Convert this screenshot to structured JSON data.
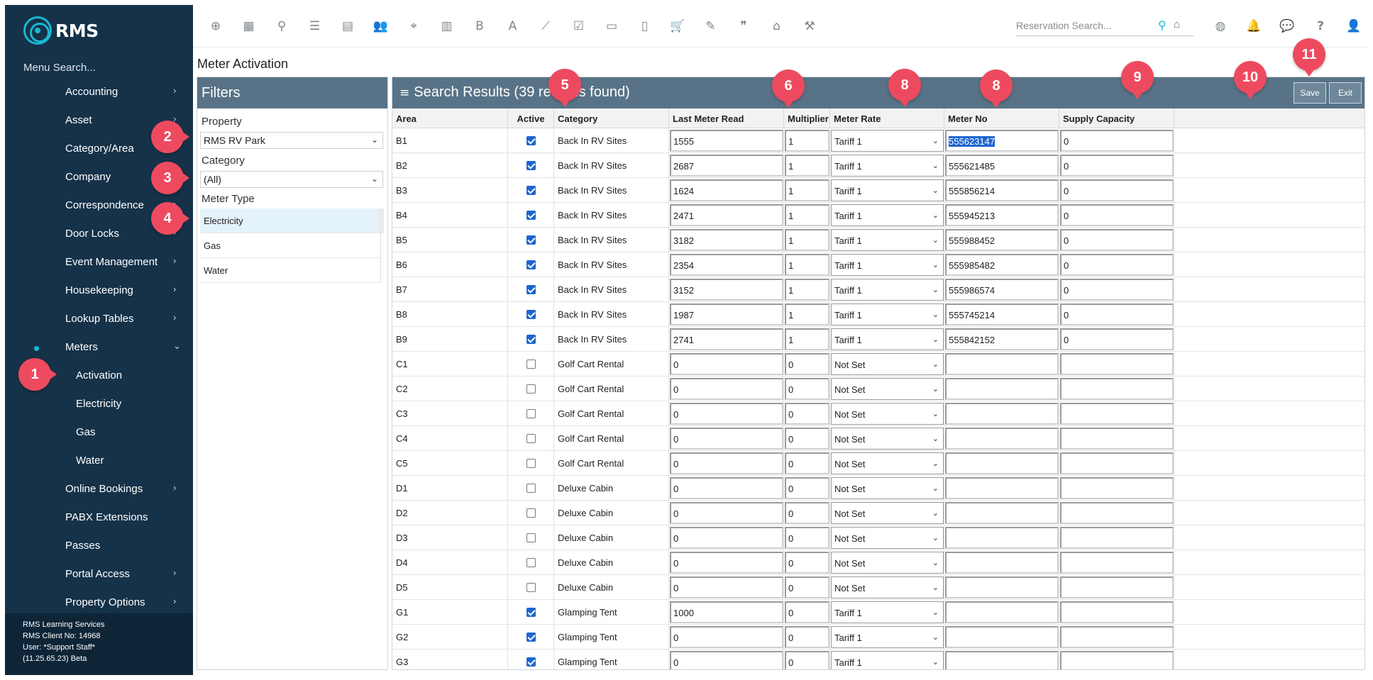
{
  "app": {
    "logo_text": "RMS",
    "menu_search_label": "Menu Search..."
  },
  "sidebar": {
    "items": [
      {
        "label": "Accounting",
        "chevron": "›"
      },
      {
        "label": "Asset",
        "chevron": "›"
      },
      {
        "label": "Category/Area",
        "chevron": ""
      },
      {
        "label": "Company",
        "chevron": "›"
      },
      {
        "label": "Correspondence",
        "chevron": "›"
      },
      {
        "label": "Door Locks",
        "chevron": "›"
      },
      {
        "label": "Event Management",
        "chevron": "›"
      },
      {
        "label": "Housekeeping",
        "chevron": "›"
      },
      {
        "label": "Lookup Tables",
        "chevron": "›"
      },
      {
        "label": "Meters",
        "chevron": "⌄"
      },
      {
        "label": "Activation",
        "chevron": ""
      },
      {
        "label": "Electricity",
        "chevron": ""
      },
      {
        "label": "Gas",
        "chevron": ""
      },
      {
        "label": "Water",
        "chevron": ""
      },
      {
        "label": "Online Bookings",
        "chevron": "›"
      },
      {
        "label": "PABX Extensions",
        "chevron": ""
      },
      {
        "label": "Passes",
        "chevron": ""
      },
      {
        "label": "Portal Access",
        "chevron": "›"
      },
      {
        "label": "Property Options",
        "chevron": "›"
      }
    ],
    "footer": {
      "line1": "RMS Learning Services",
      "line2": "RMS Client No: 14968",
      "line3": "User: *Support Staff*",
      "line4": "(11.25.65.23)  Beta"
    }
  },
  "toolbar": {
    "icons": [
      {
        "name": "add-icon",
        "glyph": "⊕"
      },
      {
        "name": "calendar-icon",
        "glyph": "▦"
      },
      {
        "name": "search-icon",
        "glyph": "⚲"
      },
      {
        "name": "sliders-icon",
        "glyph": "☰"
      },
      {
        "name": "grid-icon",
        "glyph": "▤"
      },
      {
        "name": "users-icon",
        "glyph": "👥"
      },
      {
        "name": "map-marker-icon",
        "glyph": "⌖"
      },
      {
        "name": "map-icon",
        "glyph": "▥"
      },
      {
        "name": "bold-icon",
        "glyph": "B"
      },
      {
        "name": "font-icon",
        "glyph": "A"
      },
      {
        "name": "chart-icon",
        "glyph": "⟋"
      },
      {
        "name": "checklist-icon",
        "glyph": "☑"
      },
      {
        "name": "id-card-icon",
        "glyph": "▭"
      },
      {
        "name": "document-icon",
        "glyph": "▯"
      },
      {
        "name": "cart-icon",
        "glyph": "🛒"
      },
      {
        "name": "signature-icon",
        "glyph": "✎"
      },
      {
        "name": "quote-icon",
        "glyph": "❞"
      },
      {
        "name": "bed-icon",
        "glyph": "⌂"
      },
      {
        "name": "hammer-icon",
        "glyph": "⚒"
      }
    ],
    "reservation_search_placeholder": "Reservation Search...",
    "right_icons": [
      {
        "name": "globe-icon",
        "glyph": "◍"
      },
      {
        "name": "bell-icon",
        "glyph": "🔔"
      },
      {
        "name": "chat-icon",
        "glyph": "💬"
      },
      {
        "name": "help-icon",
        "glyph": "?"
      },
      {
        "name": "user-icon",
        "glyph": "👤"
      }
    ]
  },
  "page": {
    "title": "Meter Activation"
  },
  "filters": {
    "title": "Filters",
    "property_label": "Property",
    "property_value": "RMS RV Park",
    "category_label": "Category",
    "category_value": "(All)",
    "meter_type_label": "Meter Type",
    "meter_types": [
      "Electricity",
      "Gas",
      "Water"
    ],
    "selected_meter_type": "Electricity"
  },
  "results": {
    "title": "Search Results (39 records found)",
    "save_label": "Save",
    "exit_label": "Exit",
    "columns": [
      "Area",
      "Active",
      "Category",
      "Last Meter Read",
      "Multiplier",
      "Meter Rate",
      "Meter No",
      "Supply Capacity"
    ],
    "rows": [
      {
        "area": "B1",
        "active": true,
        "category": "Back In RV Sites",
        "last_read": "1555",
        "multiplier": "1",
        "rate": "Tariff 1",
        "meter_no": "555623147",
        "capacity": "0"
      },
      {
        "area": "B2",
        "active": true,
        "category": "Back In RV Sites",
        "last_read": "2687",
        "multiplier": "1",
        "rate": "Tariff 1",
        "meter_no": "555621485",
        "capacity": "0"
      },
      {
        "area": "B3",
        "active": true,
        "category": "Back In RV Sites",
        "last_read": "1624",
        "multiplier": "1",
        "rate": "Tariff 1",
        "meter_no": "555856214",
        "capacity": "0"
      },
      {
        "area": "B4",
        "active": true,
        "category": "Back In RV Sites",
        "last_read": "2471",
        "multiplier": "1",
        "rate": "Tariff 1",
        "meter_no": "555945213",
        "capacity": "0"
      },
      {
        "area": "B5",
        "active": true,
        "category": "Back In RV Sites",
        "last_read": "3182",
        "multiplier": "1",
        "rate": "Tariff 1",
        "meter_no": "555988452",
        "capacity": "0"
      },
      {
        "area": "B6",
        "active": true,
        "category": "Back In RV Sites",
        "last_read": "2354",
        "multiplier": "1",
        "rate": "Tariff 1",
        "meter_no": "555985482",
        "capacity": "0"
      },
      {
        "area": "B7",
        "active": true,
        "category": "Back In RV Sites",
        "last_read": "3152",
        "multiplier": "1",
        "rate": "Tariff 1",
        "meter_no": "555986574",
        "capacity": "0"
      },
      {
        "area": "B8",
        "active": true,
        "category": "Back In RV Sites",
        "last_read": "1987",
        "multiplier": "1",
        "rate": "Tariff 1",
        "meter_no": "555745214",
        "capacity": "0"
      },
      {
        "area": "B9",
        "active": true,
        "category": "Back In RV Sites",
        "last_read": "2741",
        "multiplier": "1",
        "rate": "Tariff 1",
        "meter_no": "555842152",
        "capacity": "0"
      },
      {
        "area": "C1",
        "active": false,
        "category": "Golf Cart Rental",
        "last_read": "0",
        "multiplier": "0",
        "rate": "Not Set",
        "meter_no": "",
        "capacity": ""
      },
      {
        "area": "C2",
        "active": false,
        "category": "Golf Cart Rental",
        "last_read": "0",
        "multiplier": "0",
        "rate": "Not Set",
        "meter_no": "",
        "capacity": ""
      },
      {
        "area": "C3",
        "active": false,
        "category": "Golf Cart Rental",
        "last_read": "0",
        "multiplier": "0",
        "rate": "Not Set",
        "meter_no": "",
        "capacity": ""
      },
      {
        "area": "C4",
        "active": false,
        "category": "Golf Cart Rental",
        "last_read": "0",
        "multiplier": "0",
        "rate": "Not Set",
        "meter_no": "",
        "capacity": ""
      },
      {
        "area": "C5",
        "active": false,
        "category": "Golf Cart Rental",
        "last_read": "0",
        "multiplier": "0",
        "rate": "Not Set",
        "meter_no": "",
        "capacity": ""
      },
      {
        "area": "D1",
        "active": false,
        "category": "Deluxe Cabin",
        "last_read": "0",
        "multiplier": "0",
        "rate": "Not Set",
        "meter_no": "",
        "capacity": ""
      },
      {
        "area": "D2",
        "active": false,
        "category": "Deluxe Cabin",
        "last_read": "0",
        "multiplier": "0",
        "rate": "Not Set",
        "meter_no": "",
        "capacity": ""
      },
      {
        "area": "D3",
        "active": false,
        "category": "Deluxe Cabin",
        "last_read": "0",
        "multiplier": "0",
        "rate": "Not Set",
        "meter_no": "",
        "capacity": ""
      },
      {
        "area": "D4",
        "active": false,
        "category": "Deluxe Cabin",
        "last_read": "0",
        "multiplier": "0",
        "rate": "Not Set",
        "meter_no": "",
        "capacity": ""
      },
      {
        "area": "D5",
        "active": false,
        "category": "Deluxe Cabin",
        "last_read": "0",
        "multiplier": "0",
        "rate": "Not Set",
        "meter_no": "",
        "capacity": ""
      },
      {
        "area": "G1",
        "active": true,
        "category": "Glamping Tent",
        "last_read": "1000",
        "multiplier": "0",
        "rate": "Tariff 1",
        "meter_no": "",
        "capacity": ""
      },
      {
        "area": "G2",
        "active": true,
        "category": "Glamping Tent",
        "last_read": "0",
        "multiplier": "0",
        "rate": "Tariff 1",
        "meter_no": "",
        "capacity": ""
      },
      {
        "area": "G3",
        "active": true,
        "category": "Glamping Tent",
        "last_read": "0",
        "multiplier": "0",
        "rate": "Tariff 1",
        "meter_no": "",
        "capacity": ""
      }
    ]
  },
  "callouts": [
    "1",
    "2",
    "3",
    "4",
    "5",
    "6",
    "8",
    "8",
    "9",
    "10",
    "11"
  ],
  "colors": {
    "sidebar": "#153249",
    "panel_header": "#587387",
    "accent": "#19b8d2",
    "marker": "#ee4a5f"
  }
}
